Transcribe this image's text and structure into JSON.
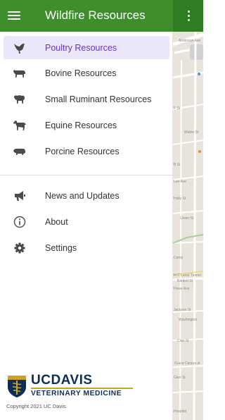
{
  "app_bar": {
    "title": "Wildfire Resources",
    "menu_icon": "hamburger-menu-icon",
    "overflow_icon": "more-vertical-icon",
    "color": "#3e8e2e"
  },
  "drawer": {
    "resources": [
      {
        "label": "Poultry Resources",
        "icon": "chicken-icon",
        "active": true
      },
      {
        "label": "Bovine Resources",
        "icon": "cow-icon",
        "active": false
      },
      {
        "label": "Small Ruminant Resources",
        "icon": "sheep-icon",
        "active": false
      },
      {
        "label": "Equine Resources",
        "icon": "horse-icon",
        "active": false
      },
      {
        "label": "Porcine Resources",
        "icon": "pig-icon",
        "active": false
      }
    ],
    "general": [
      {
        "label": "News and Updates",
        "icon": "megaphone-icon"
      },
      {
        "label": "About",
        "icon": "info-icon"
      },
      {
        "label": "Settings",
        "icon": "gear-icon"
      }
    ],
    "active_color": "#6c2dd8",
    "active_background": "#ece6fb"
  },
  "footer": {
    "logo_uc": "UC",
    "logo_davis": "DAVIS",
    "logo_subtitle": "VETERINARY MEDICINE",
    "copyright": "Copyright 2021 UC Davis"
  },
  "map": {
    "labels": [
      "Anderson Ave",
      "F St",
      "Walter St",
      "B St",
      "Lee Ave",
      "Holly St",
      "Union St",
      "Camp",
      "N C Lamp Tunnel",
      "Bartlett St",
      "Howe Ave",
      "Jackson St",
      "Washington",
      "Clair St",
      "Grace Carson st",
      "Glen St",
      "Hospital"
    ]
  }
}
